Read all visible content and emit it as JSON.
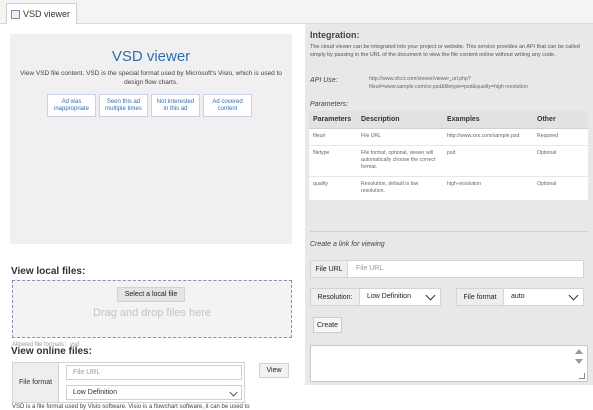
{
  "tab": {
    "label": "VSD viewer",
    "icon": "document-icon"
  },
  "viewer": {
    "title": "VSD viewer",
    "description": "View VSD file content. VSD is the special format used by Microsoft's Visio, which is used to design flow charts.",
    "ad_buttons": [
      "Ad was inappropriate",
      "Seen this ad multiple times",
      "Not interested in this ad",
      "Ad covered content"
    ]
  },
  "local_files": {
    "heading": "View local files:",
    "select_button": "Select a local file",
    "drag_text": "Drag and drop files here",
    "allowed_formats": "Allowed file formats：vsd"
  },
  "online_files": {
    "heading": "View online files:",
    "label": "File format",
    "url_placeholder": "File URL",
    "format_selected": "Low Definition",
    "view_button": "View"
  },
  "bottom_text": "VSD is a file format used by Visio software. Visio is a flowchart software, it can be used to",
  "integration": {
    "heading": "Integration:",
    "description": "The cloud viewer can be integrated into your project or website. This service provides an API that can be called simply by passing in the URL of the document to view the file content online without writing any code.",
    "api_use_label": "API Use:",
    "api_url": "http://www.xfcct.com/viewer/viewer_url.php?fileurl=www.sample.com/xx.psd&filetype=psd&quality=high resolution",
    "parameters_label": "Parameters:",
    "table_headers": [
      "Parameters",
      "Description",
      "Examples",
      "Other"
    ],
    "table_rows": [
      [
        "fileurl",
        "File URL",
        "http://www.xxx.com/sample.psd",
        "Required"
      ],
      [
        "filetype",
        "File format, optional, viewer will automatically choose the correct format.",
        "psd",
        "Optional"
      ],
      [
        "quality",
        "Resolution, default is low resolution.",
        "high-resolution",
        "Optional"
      ]
    ],
    "create_link_label": "Create a link for viewing",
    "file_url_label": "File URL",
    "file_url_placeholder": "File URL",
    "resolution_label": "Resolution:",
    "resolution_value": "Low Definition",
    "file_format_label": "File format",
    "file_format_value": "auto",
    "create_button": "Create"
  }
}
